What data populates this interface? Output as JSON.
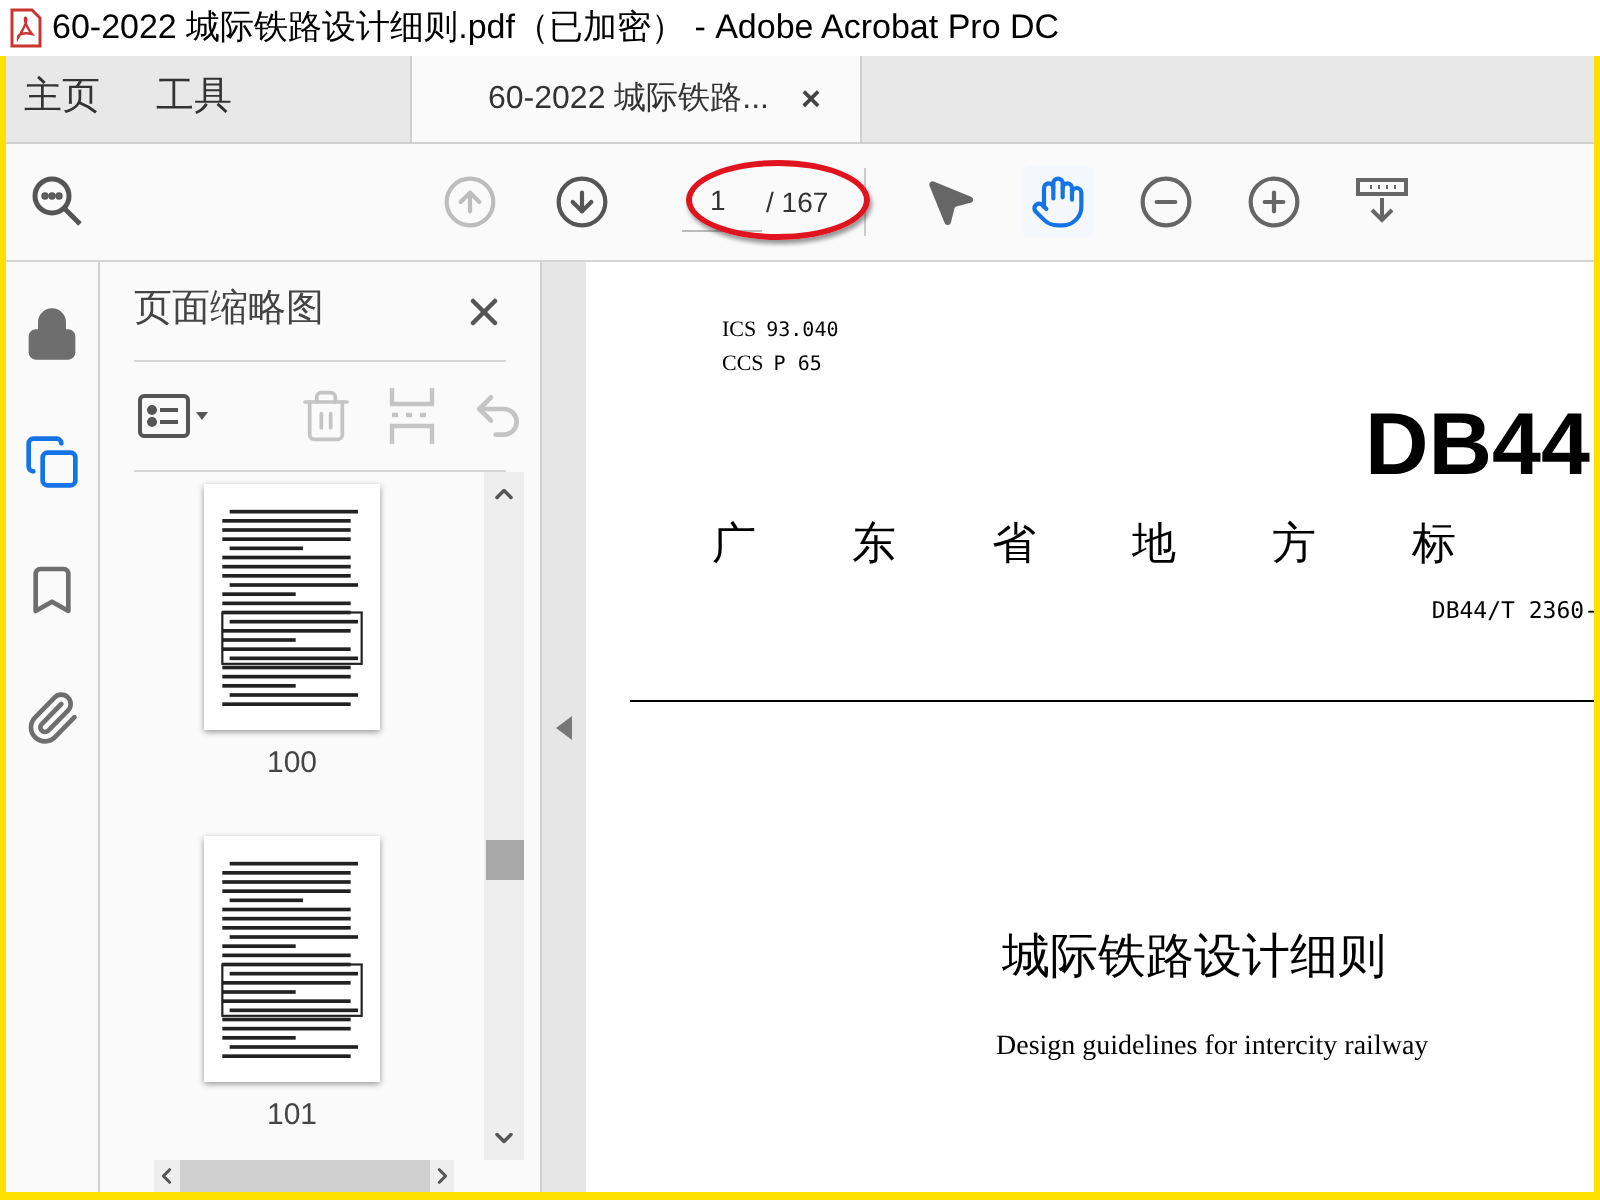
{
  "window": {
    "title": "60-2022 城际铁路设计细则.pdf（已加密） - Adobe Acrobat Pro DC"
  },
  "tabs": [
    {
      "label": "主页",
      "kind": "nav",
      "selected": false
    },
    {
      "label": "工具",
      "kind": "nav",
      "selected": false
    },
    {
      "label": "60-2022 城际铁路...",
      "kind": "document",
      "selected": true,
      "close": "×"
    }
  ],
  "toolbar": {
    "nav": [
      {
        "kind": "prev",
        "disabled": true
      },
      {
        "kind": "next",
        "disabled": false
      }
    ],
    "page_field": {
      "value": "1",
      "total": "/ 167"
    },
    "tools": [
      {
        "kind": "select",
        "selected": false
      },
      {
        "kind": "hand",
        "selected": true
      },
      {
        "kind": "zoom-out",
        "selected": false
      },
      {
        "kind": "zoom-in",
        "selected": false
      },
      {
        "kind": "fit",
        "selected": false
      }
    ]
  },
  "rail": [
    {
      "kind": "lock",
      "selected": false
    },
    {
      "kind": "pages",
      "selected": true
    },
    {
      "kind": "bookmark",
      "selected": false
    },
    {
      "kind": "attachment",
      "selected": false
    }
  ],
  "panel": {
    "title": "页面缩略图",
    "actions": [
      {
        "kind": "options",
        "disabled": false
      },
      {
        "kind": "delete",
        "disabled": true
      },
      {
        "kind": "insert",
        "disabled": true
      },
      {
        "kind": "undo",
        "disabled": true
      }
    ],
    "thumbnails": [
      {
        "label": "100"
      },
      {
        "label": "101"
      }
    ]
  },
  "document": {
    "codes": [
      {
        "label": "ICS",
        "value": "93.040"
      },
      {
        "label": "CCS",
        "value": "P 65"
      }
    ],
    "logo": "DB44",
    "heading": "广东省地方标",
    "number": "DB44/T 2360-",
    "title": "城际铁路设计细则",
    "subtitle": "Design guidelines for intercity railway"
  }
}
